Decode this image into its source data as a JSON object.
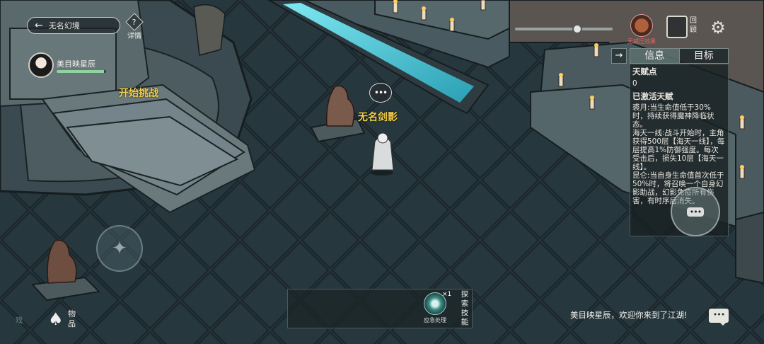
{
  "top_left": {
    "back_label": "无名幻境",
    "detail_icon_glyph": "?",
    "detail_label": "详情",
    "player_name": "美目映星辰",
    "hp_fraction": 0.95
  },
  "world_labels": {
    "challenge": "开始挑战",
    "npc_name": "无名剑影",
    "npc_bubble": "•••"
  },
  "top_right": {
    "zoom_fraction": 0.65,
    "buff_label": "无威压效果",
    "review_label": "回顾"
  },
  "info_panel": {
    "tabs": [
      "信息",
      "目标"
    ],
    "active_tab": 0,
    "talent_points_label": "天赋点",
    "talent_points_value": "0",
    "active_talents_label": "已激活天赋",
    "talents": [
      "裘月:当生命值低于30%时，持续获得魔神降临状态。",
      "海天一线:战斗开始时，主角获得500层【海天一线】，每层提高1%防御强度。每次受击后，损失10层【海天一线】。",
      "昆仑:当自身生命值首次低于50%时，将召唤一个自身幻影助战，幻影免疫所有伤害，有时序后消失。"
    ]
  },
  "bottom": {
    "inventory_label": "物品",
    "skill_count": "×1",
    "skill_label": "应急处理",
    "explore_label": "探索技能",
    "system_message": "美目映星辰，欢迎你来到了江湖!",
    "chat_glyph": "•••",
    "corner_char": "戏"
  },
  "colors": {
    "world_label": "#f6d24a",
    "buff_label": "#e46464",
    "water": "#39c6d8",
    "floor": "#24333a"
  }
}
